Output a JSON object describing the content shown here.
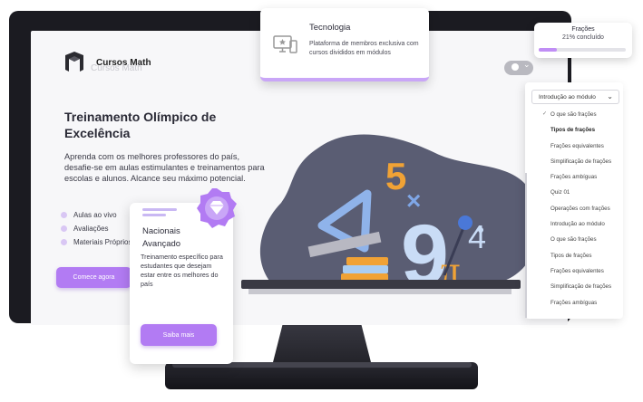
{
  "header": {
    "brand": "Cursos Math",
    "brand_shadow": "Cursos Math"
  },
  "hero": {
    "title": "Treinamento Olímpico de Excelência",
    "description": "Aprenda com os melhores professores do país, desafie-se em aulas estimulantes e treinamentos para escolas e alunos. Alcance seu máximo potencial.",
    "features": [
      "Aulas ao vivo",
      "Avaliações",
      "Materiais Próprios"
    ],
    "cta_label": "Comece agora"
  },
  "tech_card": {
    "title": "Tecnologia",
    "description": "Plataforma de membros exclusiva com cursos divididos em módulos",
    "icon": "monitor-star-icon"
  },
  "progress_card": {
    "title": "Frações",
    "subtitle": "21% concluído",
    "progress": 0.21
  },
  "sidebar": {
    "select_value": "Introdução ao módulo",
    "items": [
      "O que são frações",
      "Tipos de frações",
      "Frações equivalentes",
      "Simplificação de frações",
      "Frações ambíguas",
      "Quiz 01",
      "Operações com frações",
      "Introdução ao módulo",
      "O que são frações",
      "Tipos de frações",
      "Frações equivalentes",
      "Simplificação de frações",
      "Frações ambíguas"
    ]
  },
  "nat_card": {
    "title_line1": "Nacionais",
    "title_line2": "Avançado",
    "description": "Treinamento específico para estudantes que desejam estar entre os melhores do país",
    "button_label": "Saiba mais",
    "badge_icon": "diamond-badge-icon"
  },
  "illustration": {
    "glyphs": [
      "5",
      "×",
      "9",
      "π",
      "4"
    ]
  },
  "colors": {
    "accent": "#b27bf3",
    "accent_light": "#c9a6f7",
    "monitor": "#1b1b21",
    "blob": "#5a5d73"
  }
}
